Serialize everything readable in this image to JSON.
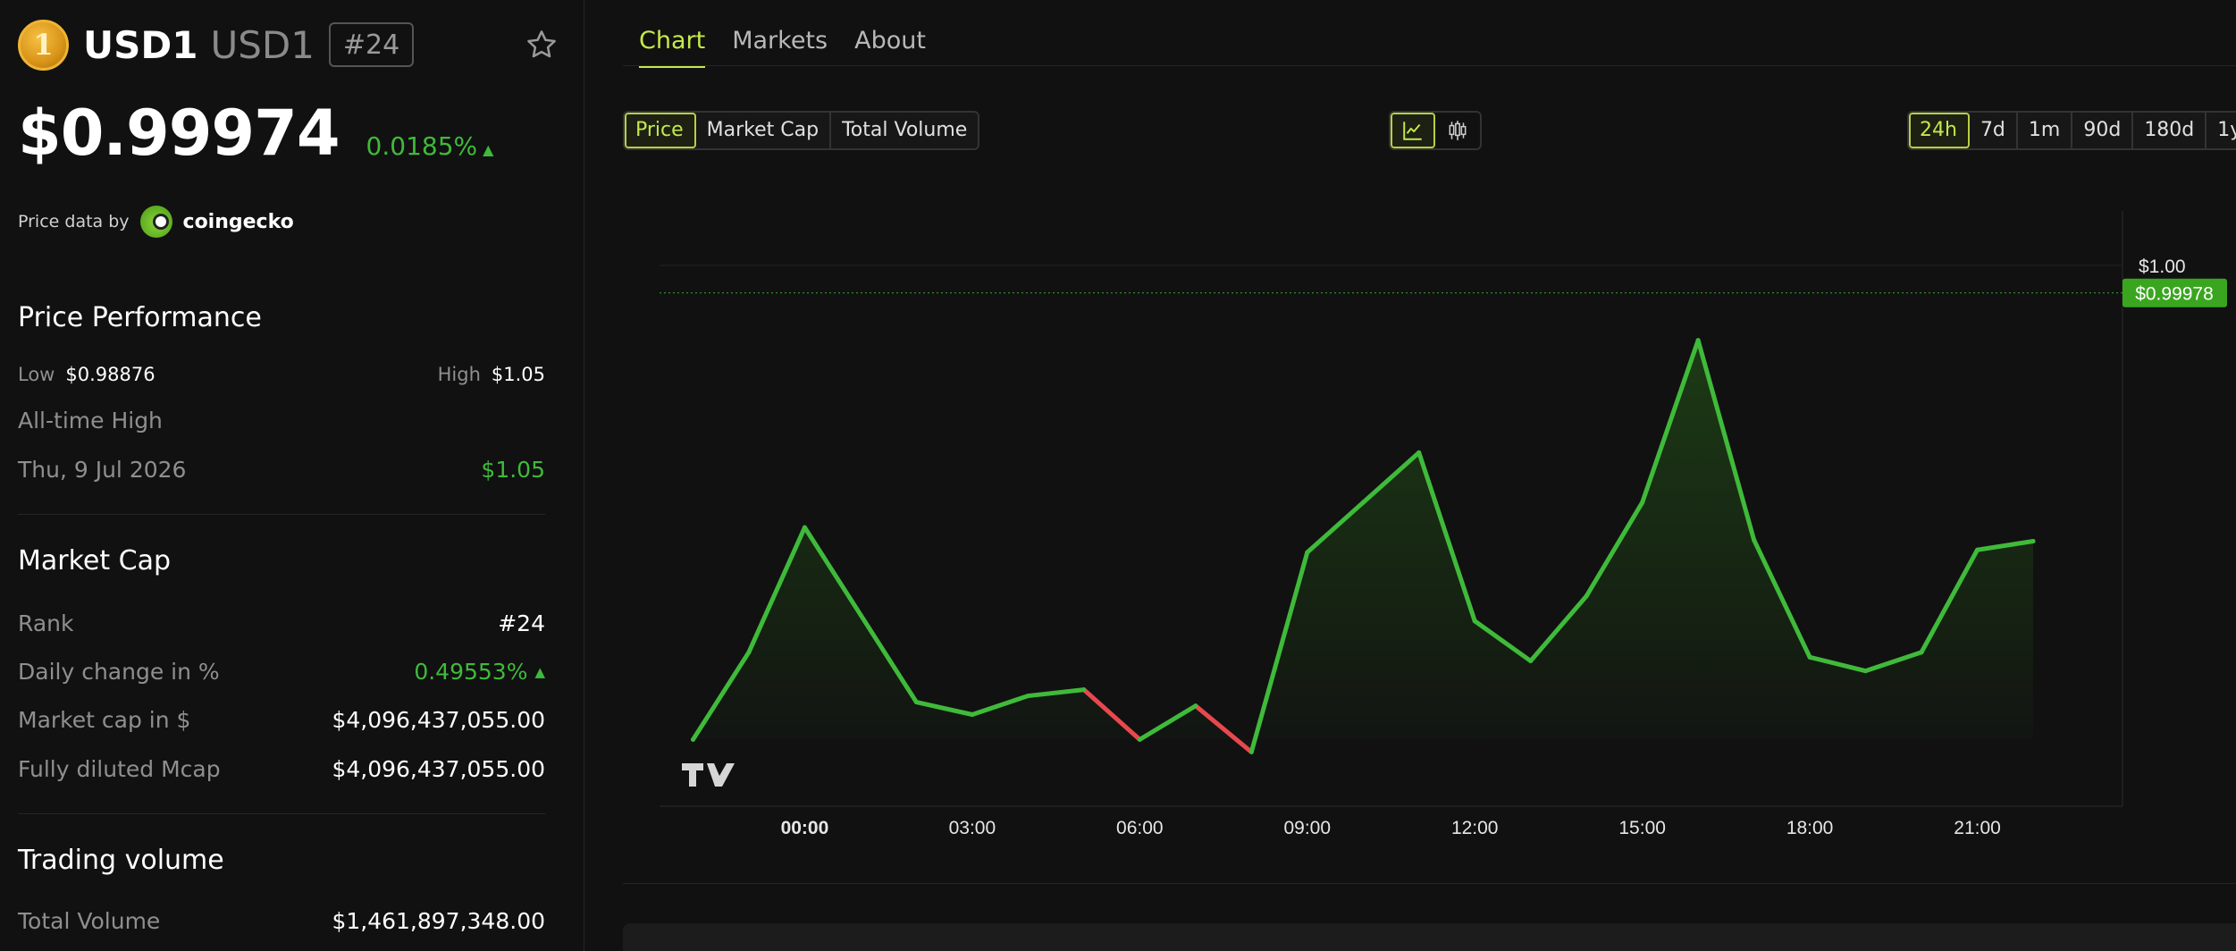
{
  "coin": {
    "logo_glyph": "1",
    "symbol": "USD1",
    "name": "USD1",
    "rank_badge": "#24",
    "price": "$0.99974",
    "change_24h": "0.0185%",
    "change_arrow": "▲"
  },
  "price_source": {
    "label": "Price data by",
    "provider": "coingecko"
  },
  "performance": {
    "title": "Price Performance",
    "low_label": "Low",
    "low_value": "$0.98876",
    "high_label": "High",
    "high_value": "$1.05",
    "ath_label": "All-time High",
    "ath_date": "Thu, 9 Jul 2026",
    "ath_value": "$1.05"
  },
  "market_cap": {
    "title": "Market Cap",
    "rank_label": "Rank",
    "rank_value": "#24",
    "daily_change_label": "Daily change in %",
    "daily_change_value": "0.49553%",
    "daily_change_arrow": "▲",
    "mcap_label": "Market cap in $",
    "mcap_value": "$4,096,437,055.00",
    "fdv_label": "Fully diluted Mcap",
    "fdv_value": "$4,096,437,055.00"
  },
  "volume": {
    "title": "Trading volume",
    "total_label": "Total Volume",
    "total_value": "$1,461,897,348.00"
  },
  "tabs": [
    {
      "label": "Chart",
      "active": true
    },
    {
      "label": "Markets",
      "active": false
    },
    {
      "label": "About",
      "active": false
    }
  ],
  "metric_buttons": [
    {
      "label": "Price",
      "active": true
    },
    {
      "label": "Market Cap",
      "active": false
    },
    {
      "label": "Total Volume",
      "active": false
    }
  ],
  "chart_type_buttons": [
    {
      "icon": "line-chart-icon",
      "active": true
    },
    {
      "icon": "candlestick-icon",
      "active": false
    }
  ],
  "range_buttons": [
    {
      "label": "24h",
      "active": true
    },
    {
      "label": "7d",
      "active": false
    },
    {
      "label": "1m",
      "active": false
    },
    {
      "label": "90d",
      "active": false
    },
    {
      "label": "180d",
      "active": false
    },
    {
      "label": "1y",
      "active": false
    }
  ],
  "colors": {
    "accent": "#c4e94b",
    "up": "#3fba3a",
    "down": "#e8484e",
    "last_price_badge": "#3aa61f"
  },
  "chart_data": {
    "type": "line",
    "x_hours": [
      -2,
      -1,
      0,
      1,
      2,
      3,
      4,
      5,
      6,
      7,
      8,
      9,
      10,
      11,
      12,
      13,
      14,
      15,
      16,
      17,
      18,
      19,
      20,
      21,
      22
    ],
    "y": [
      0.9962,
      0.9969,
      0.9979,
      0.9972,
      0.9965,
      0.9964,
      0.99655,
      0.9966,
      0.9962,
      0.99647,
      0.9961,
      0.9977,
      0.9981,
      0.9985,
      0.99715,
      0.99683,
      0.99735,
      0.9981,
      0.9994,
      0.9978,
      0.99686,
      0.99675,
      0.9969,
      0.99772,
      0.99779
    ],
    "down_segments": [
      [
        7,
        8
      ],
      [
        9,
        10
      ]
    ],
    "x_tick_labels": [
      {
        "hour": 0,
        "label": "00:00",
        "bold": true
      },
      {
        "hour": 3,
        "label": "03:00"
      },
      {
        "hour": 6,
        "label": "06:00"
      },
      {
        "hour": 9,
        "label": "09:00"
      },
      {
        "hour": 12,
        "label": "12:00"
      },
      {
        "hour": 15,
        "label": "15:00"
      },
      {
        "hour": 18,
        "label": "18:00"
      },
      {
        "hour": 21,
        "label": "21:00"
      }
    ],
    "y_ticks": [
      {
        "value": 1.0,
        "label": "$1.00"
      }
    ],
    "last_price": 0.99978,
    "last_price_label": "$0.99978",
    "ylim": [
      0.9952,
      1.0
    ],
    "xlim": [
      -2.6,
      23.6
    ],
    "grid": false
  }
}
